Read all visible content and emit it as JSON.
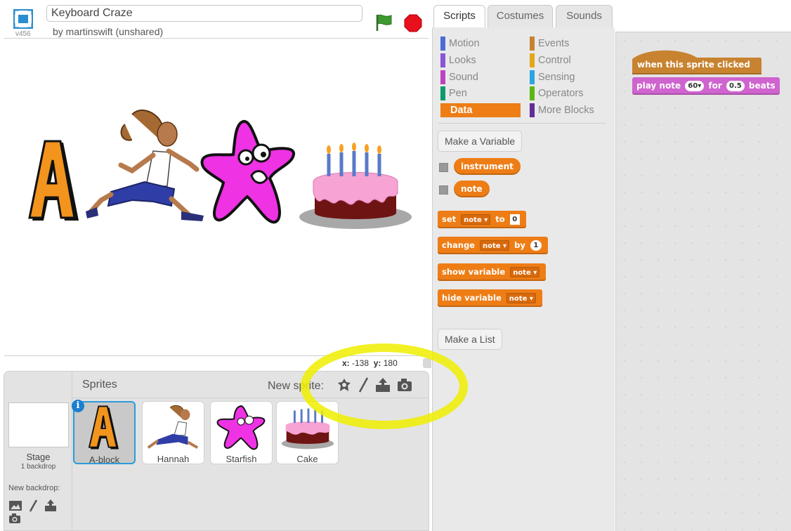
{
  "project": {
    "version": "v456",
    "title": "Keyboard Craze",
    "byline": "by martinswift (unshared)"
  },
  "stage_icons": {
    "fullscreen": "fullscreen-icon",
    "green_flag": "green-flag-icon",
    "stop": "stop-icon"
  },
  "coords": {
    "x_label": "x:",
    "x_value": "-138",
    "y_label": "y:",
    "y_value": "180"
  },
  "sprite_pane": {
    "title": "Sprites",
    "new_sprite_label": "New sprite:",
    "new_sprite_icons": [
      "sprite-library-icon",
      "paint-brush-icon",
      "upload-icon",
      "camera-icon"
    ],
    "stage": {
      "label": "Stage",
      "sub": "1 backdrop"
    },
    "new_backdrop_label": "New backdrop:",
    "new_backdrop_icons": [
      "backdrop-library-icon",
      "paint-brush-icon",
      "upload-icon",
      "camera-icon"
    ],
    "sprites": [
      {
        "name": "A-block",
        "selected": true,
        "info": "i"
      },
      {
        "name": "Hannah",
        "selected": false
      },
      {
        "name": "Starfish",
        "selected": false
      },
      {
        "name": "Cake",
        "selected": false
      }
    ]
  },
  "tabs": [
    {
      "label": "Scripts",
      "active": true
    },
    {
      "label": "Costumes",
      "active": false
    },
    {
      "label": "Sounds",
      "active": false
    }
  ],
  "categories": [
    {
      "label": "Motion",
      "color": "#4a6cd4"
    },
    {
      "label": "Looks",
      "color": "#8a55d7"
    },
    {
      "label": "Sound",
      "color": "#bb42c3"
    },
    {
      "label": "Pen",
      "color": "#0e9a6c"
    },
    {
      "label": "Data",
      "color": "#ee7d16",
      "active": true
    },
    {
      "label": "Events",
      "color": "#c88330"
    },
    {
      "label": "Control",
      "color": "#e1a91a"
    },
    {
      "label": "Sensing",
      "color": "#2ca5e2"
    },
    {
      "label": "Operators",
      "color": "#5cb712"
    },
    {
      "label": "More Blocks",
      "color": "#632d99"
    }
  ],
  "palette": {
    "make_variable": "Make a Variable",
    "variables": [
      "instrument",
      "note"
    ],
    "blocks": {
      "set": {
        "label": "set",
        "var": "note",
        "to": "to",
        "value": "0"
      },
      "change": {
        "label": "change",
        "var": "note",
        "by": "by",
        "value": "1"
      },
      "show": {
        "label": "show variable",
        "var": "note"
      },
      "hide": {
        "label": "hide variable",
        "var": "note"
      }
    },
    "make_list": "Make a List"
  },
  "script": {
    "hat": "when this sprite clicked",
    "play_note": {
      "label": "play note",
      "note": "60",
      "for": "for",
      "beats_value": "0.5",
      "beats": "beats"
    }
  },
  "colors": {
    "data": "#ee7d16",
    "sound": "#cf63cf",
    "events": "#c88330",
    "highlight": "#f0f000"
  }
}
